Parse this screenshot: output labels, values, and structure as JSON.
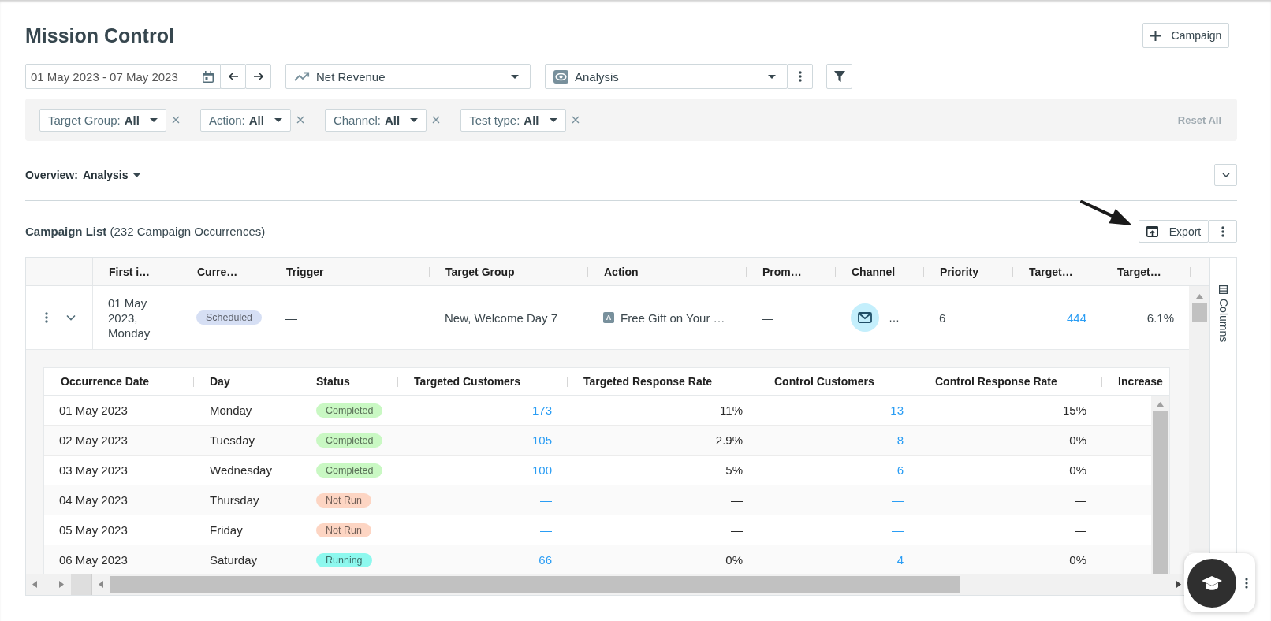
{
  "page": {
    "title": "Mission Control",
    "add_button": "Campaign"
  },
  "toolbar": {
    "date_range": "01 May 2023 - 07 May 2023",
    "metric": "Net Revenue",
    "view": "Analysis"
  },
  "filters": {
    "chips": [
      {
        "label": "Target Group:",
        "value": "All"
      },
      {
        "label": "Action:",
        "value": "All"
      },
      {
        "label": "Channel:",
        "value": "All"
      },
      {
        "label": "Test type:",
        "value": "All"
      }
    ],
    "reset": {
      "label": "Reset All",
      "disabled": true
    }
  },
  "overview": {
    "label": "Overview:",
    "value": "Analysis"
  },
  "campaign_list": {
    "title": "**Campaign List** (232 Campaign Occurrences)",
    "export": "Export"
  },
  "table": {
    "columns": [
      "First i…",
      "Curre…",
      "Trigger",
      "Target Group",
      "Action",
      "Prom…",
      "Channel",
      "Priority",
      "Target…",
      "Target…"
    ],
    "rows": [
      {
        "expanded": true,
        "cells": [
          {
            "kind": "text",
            "text": "01 May 2023, Monday"
          },
          {
            "kind": "badge",
            "text": "Scheduled",
            "color": "#d6dff4"
          },
          {
            "kind": "text",
            "text": "—"
          },
          {
            "kind": "text",
            "text": "New, Welcome Day 7"
          },
          {
            "kind": "action",
            "tag": "A",
            "text": "Free Gift on Your …"
          },
          {
            "kind": "text",
            "text": "—"
          },
          {
            "kind": "channel",
            "text": "…"
          },
          {
            "kind": "text",
            "text": "6"
          },
          {
            "kind": "link",
            "text": "444"
          },
          {
            "kind": "number",
            "text": "6.1%"
          }
        ],
        "detail": {
          "columns": [
            "Occurrence Date",
            "Day",
            "Status",
            "Targeted Customers",
            "Targeted Response Rate",
            "Control Customers",
            "Control Response Rate",
            "Increase"
          ],
          "rows": [
            {
              "date": "01 May 2023",
              "day": "Monday",
              "status": {
                "label": "Completed",
                "color": "#c9f8c3"
              },
              "targeted_customers": "173",
              "targeted_response_rate": "11%",
              "control_customers": "13",
              "control_response_rate": "15%"
            },
            {
              "date": "02 May 2023",
              "day": "Tuesday",
              "status": {
                "label": "Completed",
                "color": "#c9f8c3"
              },
              "targeted_customers": "105",
              "targeted_response_rate": "2.9%",
              "control_customers": "8",
              "control_response_rate": "0%"
            },
            {
              "date": "03 May 2023",
              "day": "Wednesday",
              "status": {
                "label": "Completed",
                "color": "#c9f8c3"
              },
              "targeted_customers": "100",
              "targeted_response_rate": "5%",
              "control_customers": "6",
              "control_response_rate": "0%"
            },
            {
              "date": "04 May 2023",
              "day": "Thursday",
              "status": {
                "label": "Not Run",
                "color": "#fdd5c3"
              },
              "targeted_customers": "—",
              "targeted_response_rate": "—",
              "control_customers": "—",
              "control_response_rate": "—"
            },
            {
              "date": "05 May 2023",
              "day": "Friday",
              "status": {
                "label": "Not Run",
                "color": "#fdd5c3"
              },
              "targeted_customers": "—",
              "targeted_response_rate": "—",
              "control_customers": "—",
              "control_response_rate": "—"
            },
            {
              "date": "06 May 2023",
              "day": "Saturday",
              "status": {
                "label": "Running",
                "color": "#8df8ee"
              },
              "targeted_customers": "66",
              "targeted_response_rate": "0%",
              "control_customers": "4",
              "control_response_rate": "0%"
            }
          ]
        }
      }
    ]
  },
  "side_panel": {
    "label": "Columns"
  }
}
